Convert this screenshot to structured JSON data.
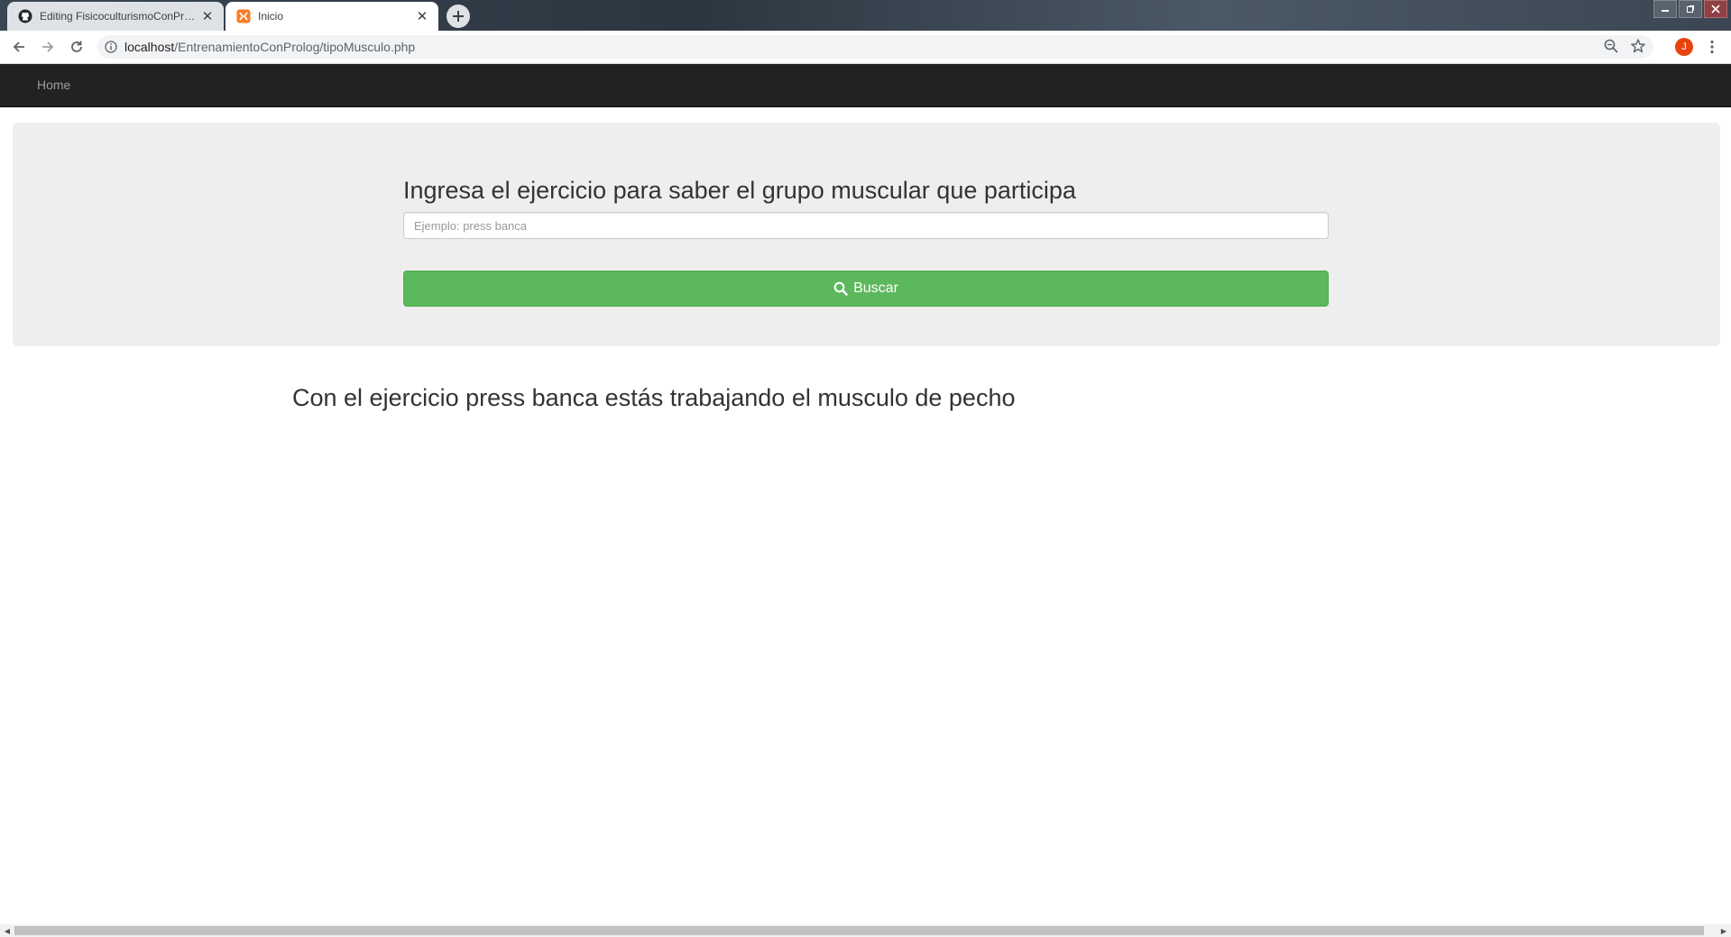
{
  "browser": {
    "tabs": [
      {
        "title": "Editing FisicoculturismoConProlog",
        "icon": "github-icon",
        "close": "✕"
      },
      {
        "title": "Inicio",
        "icon": "xampp-icon",
        "close": "✕"
      }
    ],
    "url_host": "localhost",
    "url_path": "/EntrenamientoConProlog/tipoMusculo.php",
    "profile_initial": "J",
    "profile_color": "#e8430f"
  },
  "navbar": {
    "home_label": "Home"
  },
  "search": {
    "heading": "Ingresa el ejercicio para saber el grupo muscular que participa",
    "placeholder": "Ejemplo: press banca",
    "button_label": "Buscar",
    "button_color": "#5cb85c"
  },
  "result": {
    "text": "Con el ejercicio press banca estás trabajando el musculo de pecho"
  }
}
